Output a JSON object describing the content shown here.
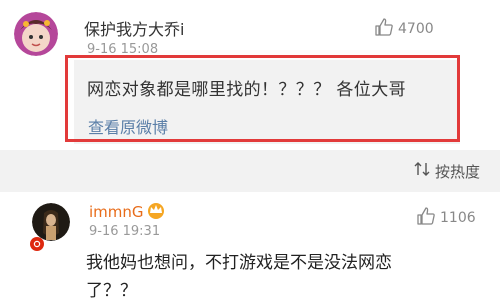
{
  "top_comment": {
    "username": "保护我方大乔i",
    "time": "9-16 15:08",
    "like_count": "4700",
    "quoted_text": "网恋对象都是哪里找的！？？？ 各位大哥",
    "view_original_label": "查看原微博"
  },
  "sort": {
    "label": "按热度"
  },
  "reply": {
    "username": "immnG",
    "time": "9-16 19:31",
    "like_count": "1106",
    "text_line1": "我他妈也想问，不打游戏是不是没法网恋",
    "text_line2": "了？？"
  },
  "colors": {
    "highlight_border": "#e23a3a",
    "link": "#5b7fa8",
    "username_accent": "#e86c1a"
  }
}
